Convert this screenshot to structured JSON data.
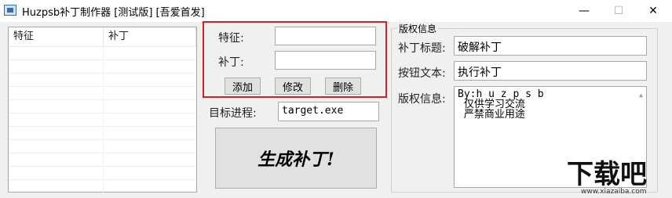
{
  "window": {
    "title": "Huzpsb补丁制作器 [测试版] [吾爱首发]",
    "minimize": "—",
    "maximize": "☐",
    "close": "✕"
  },
  "list": {
    "columns": [
      "特征",
      "补丁"
    ]
  },
  "editor": {
    "feature_label": "特征:",
    "feature_value": "",
    "patch_label": "补丁:",
    "patch_value": "",
    "add_button": "添加",
    "edit_button": "修改",
    "delete_button": "删除"
  },
  "target": {
    "label": "目标进程:",
    "value": "target.exe"
  },
  "generate_button": "生成补丁!",
  "copyright": {
    "group_title": "版权信息",
    "patch_title_label": "补丁标题:",
    "patch_title_value": "破解补丁",
    "button_text_label": "按钮文本:",
    "button_text_value": "执行补丁",
    "info_label": "版权信息:",
    "info_lines": [
      "By:h u z p s b",
      " 仅供学习交流",
      " 严禁商业用途"
    ]
  },
  "watermark": {
    "logo_text": "下载吧",
    "url": "www.xiazaiba.com"
  }
}
